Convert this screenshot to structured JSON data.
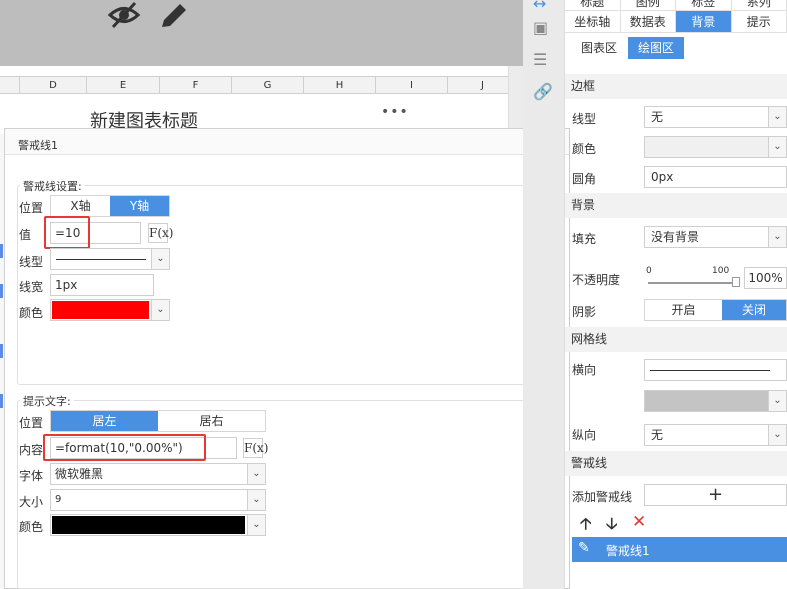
{
  "toolbar": {
    "hide_icon": "eye-slash-icon",
    "edit_icon": "pencil-icon"
  },
  "sheet": {
    "columns": [
      "D",
      "E",
      "F",
      "G",
      "H",
      "I",
      "J"
    ],
    "chart_title": "新建图表标题",
    "more_menu": "•••"
  },
  "dialog": {
    "title": "警戒线1",
    "line_settings": {
      "title": "警戒线设置:",
      "position_label": "位置",
      "x_axis": "X轴",
      "y_axis": "Y轴",
      "value_label": "值",
      "value": "=10",
      "fx_label": "F(x)",
      "linetype_label": "线型",
      "linewidth_label": "线宽",
      "linewidth_value": "1px",
      "color_label": "颜色",
      "color_value": "#ff0000"
    },
    "hint_text": {
      "title": "提示文字:",
      "position_label": "位置",
      "left": "居左",
      "right": "居右",
      "content_label": "内容",
      "content_value": "=format(10,\"0.00%\")",
      "fx_label": "F(x)",
      "font_label": "字体",
      "font_value": "微软雅黑",
      "size_label": "大小",
      "size_value": "9",
      "color_label": "颜色",
      "color_value": "#000000"
    }
  },
  "right_panel": {
    "top_tabs_row1": [
      "标题",
      "图例",
      "标签",
      "系列"
    ],
    "top_tabs_row2": [
      "坐标轴",
      "数据表",
      "背景",
      "提示"
    ],
    "active_tab": "背景",
    "sub_tabs": [
      "图表区",
      "绘图区"
    ],
    "active_sub_tab": "绘图区",
    "border_section": "边框",
    "line_label": "线型",
    "line_value": "无",
    "color_label": "颜色",
    "radius_label": "圆角",
    "radius_value": "0px",
    "bg_section": "背景",
    "fill_label": "填充",
    "fill_value": "没有背景",
    "opacity_label": "不透明度",
    "opacity_min": "0",
    "opacity_max": "100",
    "opacity_value": "100%",
    "shadow_label": "阴影",
    "shadow_on": "开启",
    "shadow_off": "关闭",
    "grid_section": "网格线",
    "horizontal_label": "横向",
    "vertical_label": "纵向",
    "vertical_value": "无",
    "alert_section": "警戒线",
    "add_alert_label": "添加警戒线",
    "add_symbol": "+",
    "alert_items": [
      "警戒线1"
    ]
  }
}
